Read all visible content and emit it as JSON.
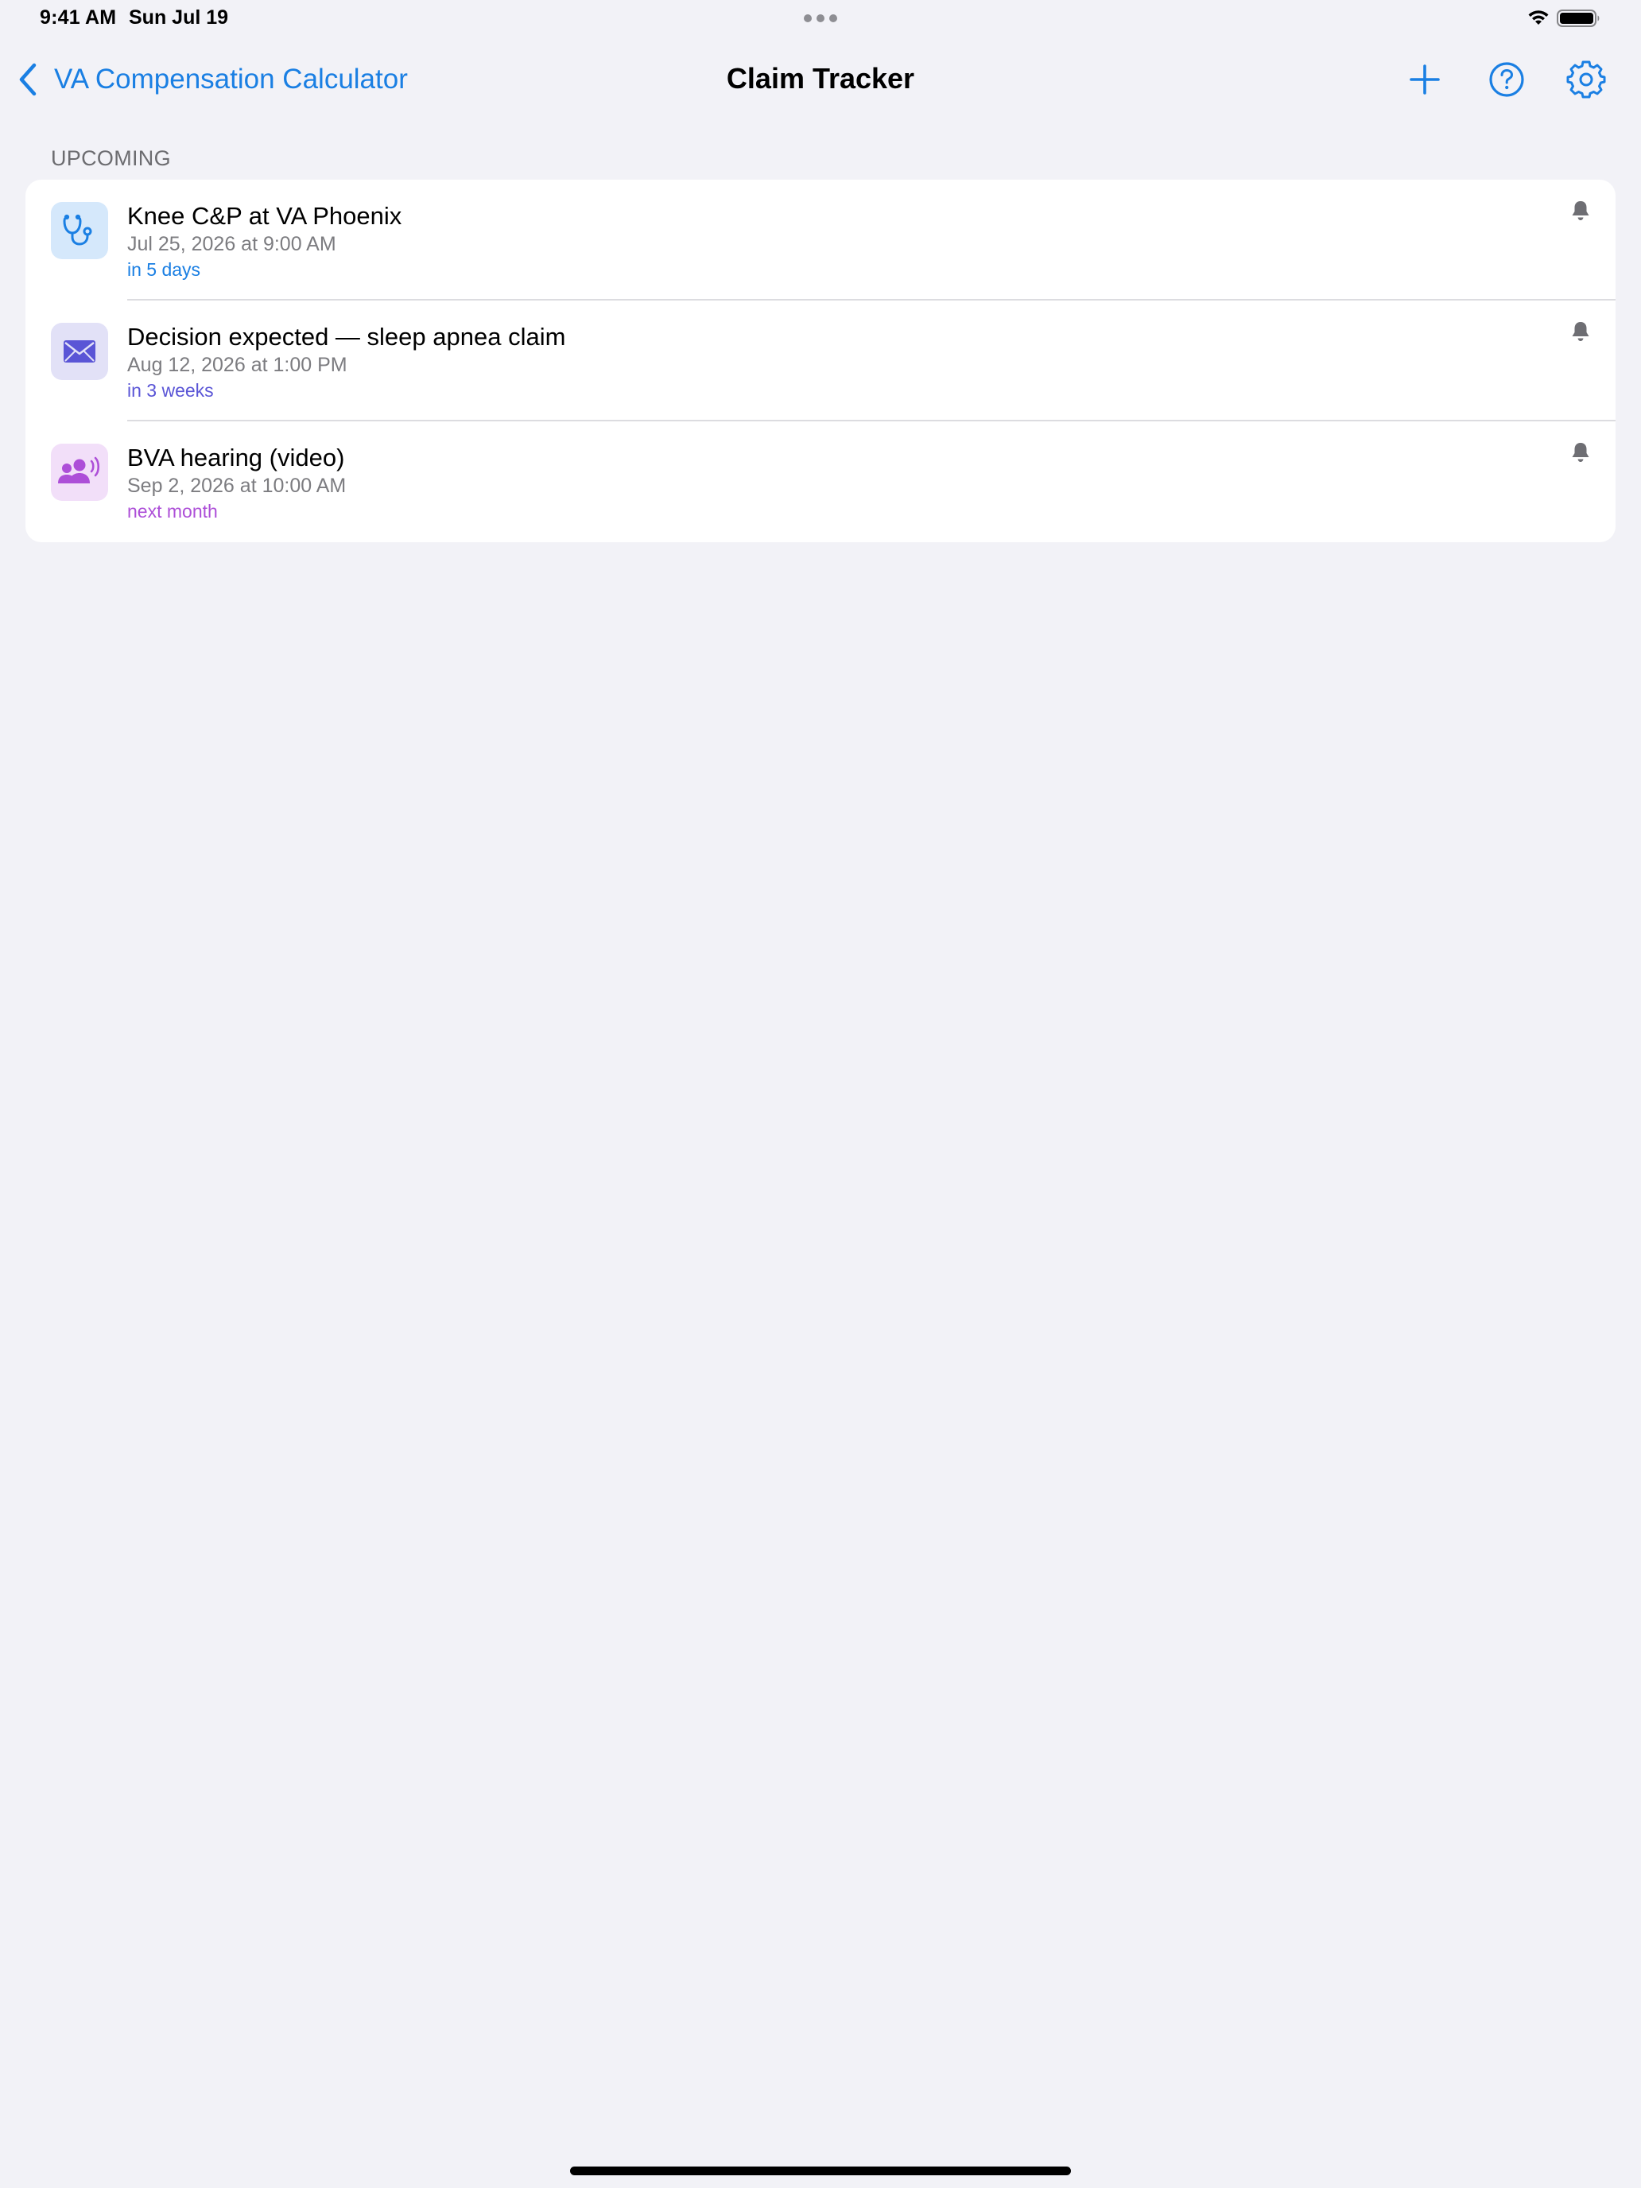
{
  "status_bar": {
    "time": "9:41 AM",
    "date": "Sun Jul 19"
  },
  "nav": {
    "back_label": "VA Compensation Calculator",
    "title": "Claim Tracker",
    "actions": [
      "plus-icon",
      "question-circle-icon",
      "gear-icon"
    ]
  },
  "section": {
    "header": "UPCOMING"
  },
  "items": [
    {
      "title": "Knee C&P at VA Phoenix",
      "date": "Jul 25, 2026 at 9:00 AM",
      "relative": "in 5 days",
      "icon": "stethoscope-icon",
      "accent": "#1a7fe3",
      "icon_bg": "#d5e8fb"
    },
    {
      "title": "Decision expected — sleep apnea claim",
      "date": "Aug 12, 2026 at 1:00 PM",
      "relative": "in 3 weeks",
      "icon": "envelope-icon",
      "accent": "#5a55d6",
      "icon_bg": "#e2e1f7"
    },
    {
      "title": "BVA hearing (video)",
      "date": "Sep 2, 2026 at 10:00 AM",
      "relative": "next month",
      "icon": "people-speaking-icon",
      "accent": "#ad4fd8",
      "icon_bg": "#f2dff9"
    }
  ],
  "colors": {
    "tint": "#1a7fe3",
    "background": "#f2f2f7",
    "secondary_text": "#7c7c80"
  }
}
